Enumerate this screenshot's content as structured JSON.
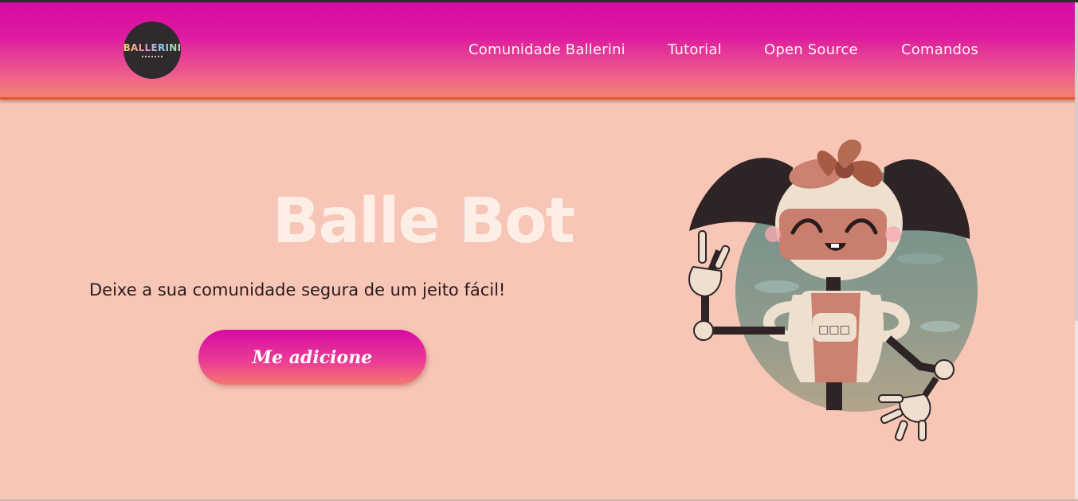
{
  "header": {
    "logo_text": "BALLERINI",
    "nav": [
      {
        "label": "Comunidade Ballerini"
      },
      {
        "label": "Tutorial"
      },
      {
        "label": "Open Source"
      },
      {
        "label": "Comandos"
      }
    ]
  },
  "hero": {
    "title": "Balle Bot",
    "subtitle": "Deixe a sua comunidade segura de um jeito fácil!",
    "cta_label": "Me adicione",
    "illustration": "robot-mascot",
    "robot_badge_text": "□□□"
  },
  "colors": {
    "header_top": "#d80aa4",
    "header_bottom": "#f4866e",
    "background": "#f7c6b7",
    "title": "#fdeee6"
  }
}
